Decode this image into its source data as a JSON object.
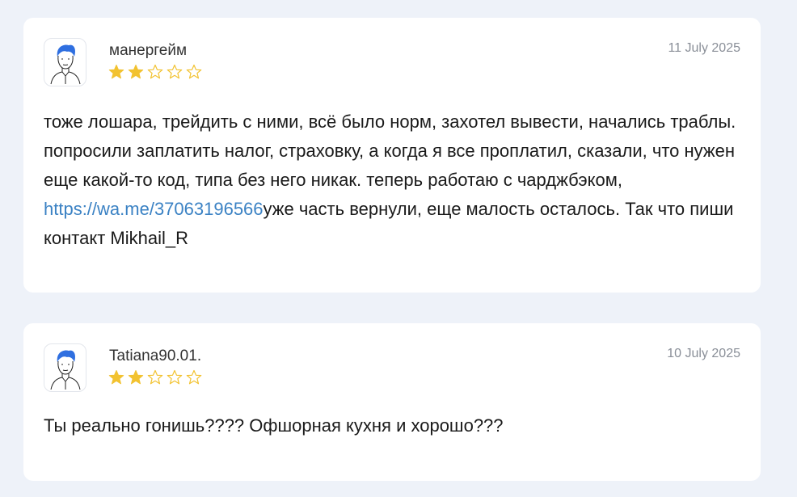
{
  "reviews": [
    {
      "author": "манергейм",
      "date": "11 July 2025",
      "rating": 2,
      "max_rating": 5,
      "avatar_icon": "user-avatar-icon",
      "text_before_link": "тоже лошара, трейдить с ними, всё было норм, захотел вывести, начались траблы. попросили заплатить налог, страховку, а когда я все проплатил, сказали, что нужен еще какой-то код, типа без него никак. теперь работаю с чарджбэком, ",
      "link_text": "https://wa.me/37063196566",
      "text_after_link": "уже часть вернули, еще малость осталось. Так что пиши контакт Mikhail_R"
    },
    {
      "author": "Tatiana90.01.",
      "date": "10 July 2025",
      "rating": 2,
      "max_rating": 5,
      "avatar_icon": "user-avatar-icon",
      "text": "Ты реально гонишь???? Офшорная кухня и хорошо???"
    }
  ],
  "colors": {
    "page_background": "#eef2f9",
    "card_background": "#ffffff",
    "star_filled": "#f2c230",
    "star_empty_outline": "#f2c230",
    "link": "#3b82c4",
    "date_text": "#8a8f98",
    "avatar_hair": "#2f6fe0"
  }
}
